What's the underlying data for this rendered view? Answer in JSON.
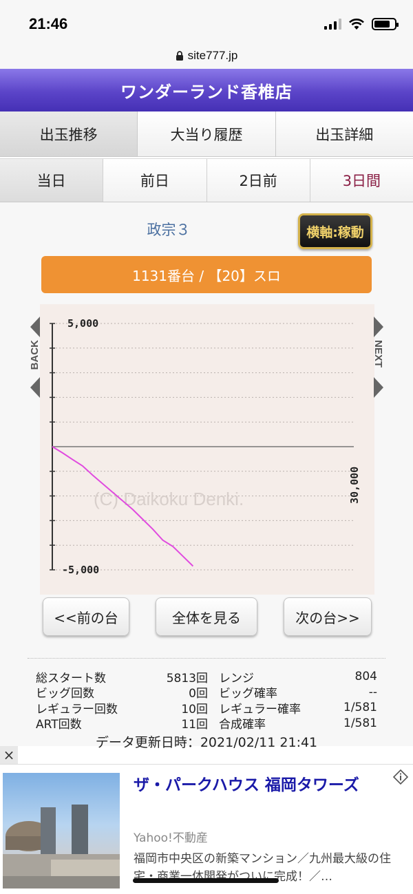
{
  "status_bar": {
    "time": "21:46"
  },
  "browser": {
    "url": "site777.jp"
  },
  "header": {
    "title": "ワンダーランド香椎店"
  },
  "tabs_primary": [
    {
      "label": "出玉推移"
    },
    {
      "label": "大当り履歴"
    },
    {
      "label": "出玉詳細"
    }
  ],
  "tabs_secondary": [
    {
      "label": "当日"
    },
    {
      "label": "前日"
    },
    {
      "label": "2日前"
    },
    {
      "label": "3日間"
    }
  ],
  "machine": {
    "name": "政宗３",
    "axis_button": "横軸:稼動",
    "unit_label": "1131番台 / 【20】スロ"
  },
  "chart_nav": {
    "back": "BACK",
    "next": "NEXT"
  },
  "chart_data": {
    "type": "line",
    "title": "",
    "xlabel": "",
    "ylabel": "",
    "ylim": [
      -5000,
      5000
    ],
    "xlim": [
      0,
      30000
    ],
    "x_tick_label": "30,000",
    "y_tick_labels": [
      "5,000",
      "-5,000"
    ],
    "watermark": "(C) Daikoku Denki.",
    "grid": true,
    "line_color": "#e04adf",
    "series": [
      {
        "x": [
          0,
          1000,
          2000,
          3000,
          4000,
          5000,
          6000,
          7000,
          8000,
          9000,
          10000,
          11000,
          12000,
          13000,
          14000
        ],
        "y": [
          0,
          -250,
          -520,
          -780,
          -1150,
          -1500,
          -1850,
          -2200,
          -2550,
          -2950,
          -3350,
          -3800,
          -4050,
          -4450,
          -4850
        ]
      }
    ]
  },
  "actions": {
    "prev": "<<前の台",
    "all": "全体を見る",
    "next": "次の台>>"
  },
  "stats": {
    "rows": [
      {
        "l1": "総スタート数",
        "v1": "5813回",
        "l2": "レンジ",
        "v2": "804"
      },
      {
        "l1": "ビッグ回数",
        "v1": "0回",
        "l2": "ビッグ確率",
        "v2": "--"
      },
      {
        "l1": "レギュラー回数",
        "v1": "10回",
        "l2": "レギュラー確率",
        "v2": "1/581"
      },
      {
        "l1": "ART回数",
        "v1": "11回",
        "l2": "合成確率",
        "v2": "1/581"
      }
    ],
    "updated": "データ更新日時：2021/02/11 21:41"
  },
  "ad": {
    "close": "×",
    "title": "ザ・パークハウス 福岡タワーズ",
    "source": "Yahoo!不動産",
    "description": "福岡市中央区の新築マンション／九州最大級の住宅・商業一体開発がついに完成！／…"
  }
}
